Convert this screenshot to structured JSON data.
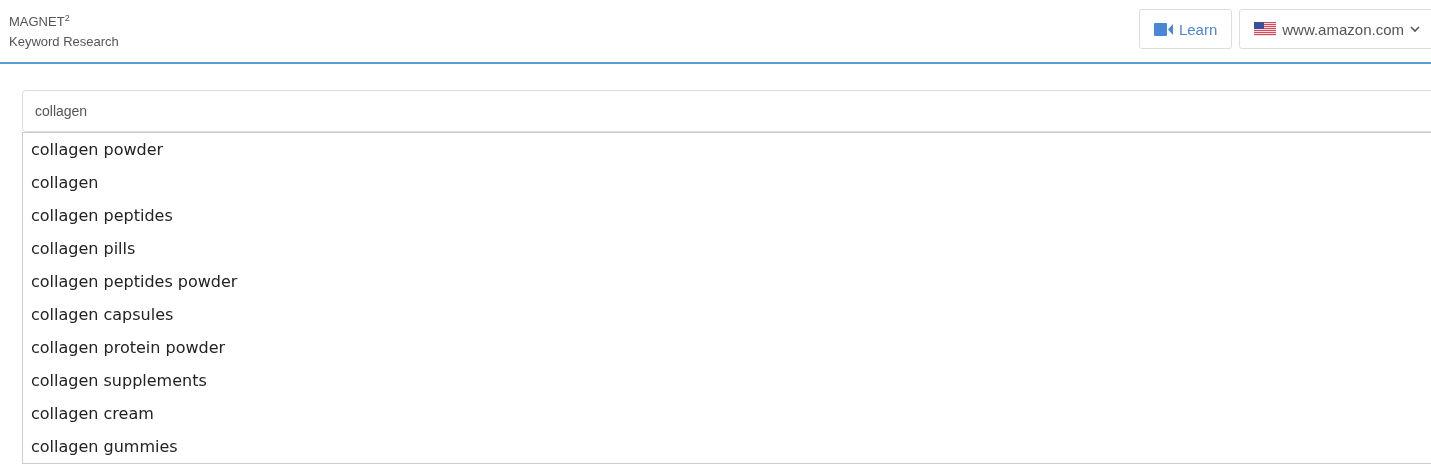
{
  "header": {
    "brand": "MAGNET$^{2}$",
    "subtitle": "Keyword Research",
    "learn_button": "Learn",
    "marketplace": "www.amazon.com"
  },
  "search": {
    "value": "collagen"
  },
  "suggestions": [
    "collagen powder",
    "collagen",
    "collagen peptides",
    "collagen pills",
    "collagen peptides powder",
    "collagen capsules",
    "collagen protein powder",
    "collagen supplements",
    "collagen cream",
    "collagen gummies"
  ]
}
